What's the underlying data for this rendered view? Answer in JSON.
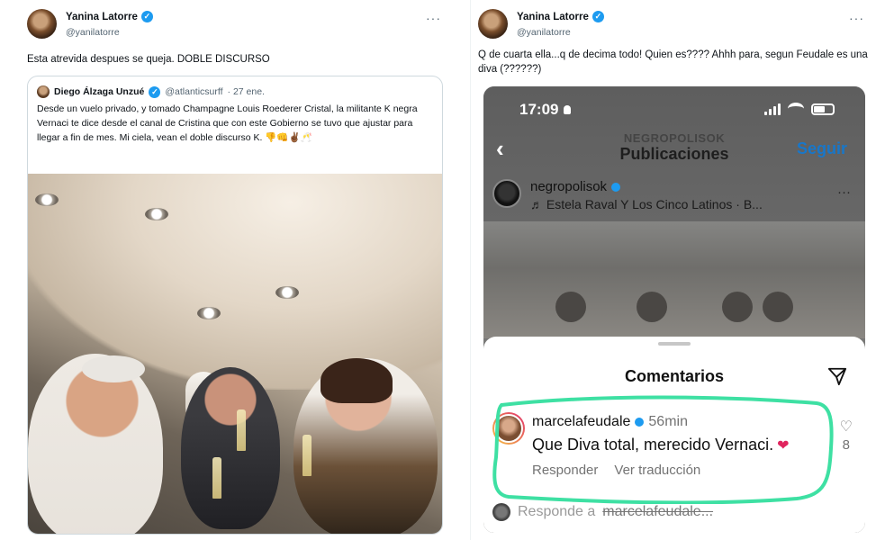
{
  "left_tweet": {
    "author": "Yanina Latorre",
    "handle": "@yanilatorre",
    "text": "Esta atrevida despues se queja. DOBLE DISCURSO",
    "more": "···",
    "quote": {
      "author": "Diego Álzaga Unzué",
      "handle": "@atlanticsurff",
      "date": "· 27 ene.",
      "text": "Desde un vuelo privado, y tomado Champagne Louis Roederer Cristal, la militante K negra Vernaci te dice desde el canal de Cristina que con este Gobierno se tuvo que ajustar para llegar a fin de mes. Mi ciela, vean el doble discurso K. 👎👊✌🏾🥂"
    }
  },
  "right_tweet": {
    "author": "Yanina Latorre",
    "handle": "@yanilatorre",
    "text": "Q de cuarta ella...q de decima todo! Quien es???? Ahhh para, segun Feudale es una diva (??????)",
    "more": "···",
    "instagram": {
      "time": "17:09",
      "nav_user": "NEGROPOLISOK",
      "nav_title": "Publicaciones",
      "follow": "Seguir",
      "post_user": "negropolisok",
      "song": "♬ Estela Raval Y Los Cinco Latinos · B...",
      "post_more": "···",
      "sheet_title": "Comentarios",
      "comment": {
        "user": "marcelafeudale",
        "time": "56min",
        "text": "Que Diva total, merecido Vernaci.",
        "reply": "Responder",
        "translate": "Ver traducción",
        "likes": "8"
      },
      "reply_prefix": "Responde a",
      "reply_user": "marcelafeudale..."
    }
  },
  "colors": {
    "verified": "#1d9bf0",
    "highlight": "#3ee0a3",
    "follow": "#1877c9",
    "heart": "#e0245e"
  }
}
